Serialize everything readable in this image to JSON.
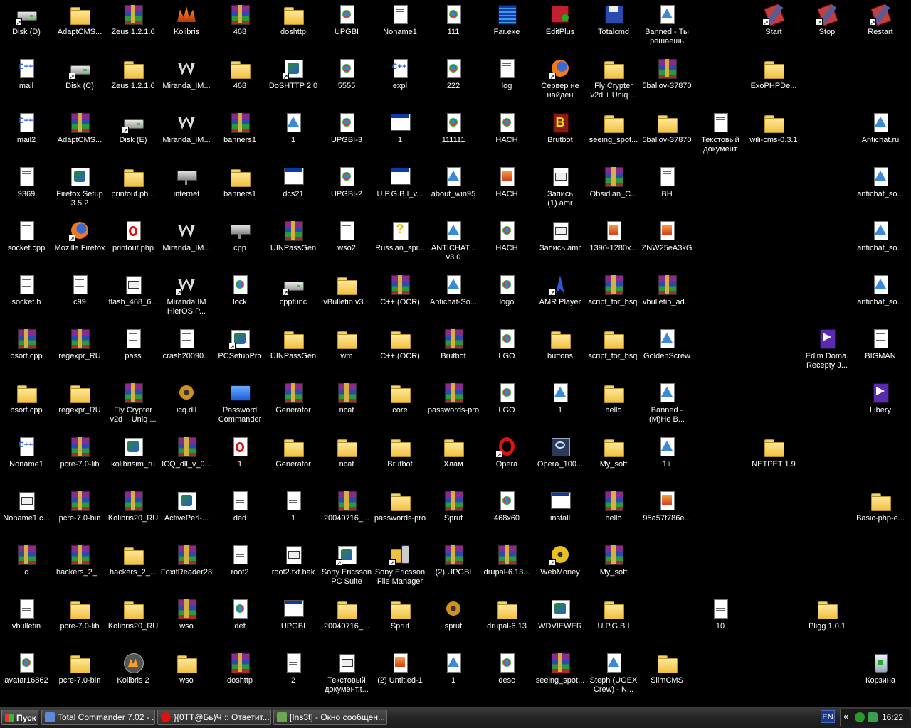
{
  "desktop": {
    "icons": [
      {
        "label": "Disk (D)",
        "glyph": "drive-icon",
        "shortcut": true
      },
      {
        "label": "AdaptCMS...",
        "glyph": "folder-icon"
      },
      {
        "label": "Zeus 1.2.1.6",
        "glyph": "rar-archive-icon"
      },
      {
        "label": "Kolibris",
        "glyph": "kolibri-icon"
      },
      {
        "label": "468",
        "glyph": "rar-archive-icon"
      },
      {
        "label": "doshttp",
        "glyph": "folder-icon"
      },
      {
        "label": "UPGBI",
        "glyph": "html-document-icon"
      },
      {
        "label": "Noname1",
        "glyph": "document-icon"
      },
      {
        "label": "111",
        "glyph": "html-document-icon"
      },
      {
        "label": "Far.exe",
        "glyph": "far-manager-icon"
      },
      {
        "label": "EditPlus",
        "glyph": "editplus-icon"
      },
      {
        "label": "Totalcmd",
        "glyph": "floppy-disk-icon"
      },
      {
        "label": "Banned - Ты решаешь",
        "glyph": "triangle-document-icon"
      },
      {
        "label": "Start",
        "glyph": "tool-flag-icon",
        "shortcut": true
      },
      {
        "label": "Stop",
        "glyph": "tool-flag-icon",
        "shortcut": true
      },
      {
        "label": "Restart",
        "glyph": "tool-flag-icon",
        "shortcut": true
      },
      {
        "label": "mail",
        "glyph": "cpp-file-icon"
      },
      {
        "label": "Disk (C)",
        "glyph": "drive-icon",
        "shortcut": true
      },
      {
        "label": "Zeus 1.2.1.6",
        "glyph": "folder-icon"
      },
      {
        "label": "Miranda_IM...",
        "glyph": "miranda-icon"
      },
      {
        "label": "468",
        "glyph": "folder-icon"
      },
      {
        "label": "DoSHTTP 2.0",
        "glyph": "application-icon",
        "shortcut": true
      },
      {
        "label": "5555",
        "glyph": "html-document-icon"
      },
      {
        "label": "expl",
        "glyph": "cpp-file-icon"
      },
      {
        "label": "222",
        "glyph": "html-document-icon"
      },
      {
        "label": "log",
        "glyph": "text-file-icon"
      },
      {
        "label": "Сервер не найден",
        "glyph": "firefox-icon",
        "shortcut": true
      },
      {
        "label": "Fly Crypter v2d + Uniq ...",
        "glyph": "folder-icon"
      },
      {
        "label": "5ballov-37870",
        "glyph": "rar-archive-icon"
      },
      {
        "label": "ExoPHPDe...",
        "glyph": "folder-icon"
      },
      {
        "label": "mail2",
        "glyph": "cpp-file-icon"
      },
      {
        "label": "AdaptCMS...",
        "glyph": "rar-archive-icon"
      },
      {
        "label": "Disk (E)",
        "glyph": "drive-icon",
        "shortcut": true
      },
      {
        "label": "Miranda_IM...",
        "glyph": "miranda-icon"
      },
      {
        "label": "banners1",
        "glyph": "rar-archive-icon"
      },
      {
        "label": "1",
        "glyph": "triangle-document-icon"
      },
      {
        "label": "UPGBI-3",
        "glyph": "html-document-icon"
      },
      {
        "label": "1",
        "glyph": "window-icon"
      },
      {
        "label": "111111",
        "glyph": "html-document-icon"
      },
      {
        "label": "HACH",
        "glyph": "html-document-icon"
      },
      {
        "label": "Brutbot",
        "glyph": "brutbot-icon"
      },
      {
        "label": "seeing_spot...",
        "glyph": "folder-icon"
      },
      {
        "label": "5ballov-37870",
        "glyph": "folder-icon"
      },
      {
        "label": "Текстовый документ",
        "glyph": "text-file-icon"
      },
      {
        "label": "wili-cms-0.3.1",
        "glyph": "folder-icon"
      },
      {
        "label": "Antichat.ru",
        "glyph": "triangle-document-icon"
      },
      {
        "label": "9369",
        "glyph": "text-file-icon"
      },
      {
        "label": "Firefox Setup 3.5.2",
        "glyph": "installer-icon"
      },
      {
        "label": "printout.ph...",
        "glyph": "folder-icon"
      },
      {
        "label": "internet",
        "glyph": "network-drive-icon"
      },
      {
        "label": "banners1",
        "glyph": "folder-icon"
      },
      {
        "label": "dcs21",
        "glyph": "window-icon"
      },
      {
        "label": "UPGBI-2",
        "glyph": "html-document-icon"
      },
      {
        "label": "U.P.G.B.I_v...",
        "glyph": "window-icon"
      },
      {
        "label": "about_win95",
        "glyph": "triangle-document-icon"
      },
      {
        "label": "HACH",
        "glyph": "image-document-icon"
      },
      {
        "label": "Запись (1).amr",
        "glyph": "executable-icon"
      },
      {
        "label": "Obsidian_C...",
        "glyph": "rar-archive-icon"
      },
      {
        "label": "BH",
        "glyph": "text-file-icon"
      },
      {
        "label": "antichat_so...",
        "glyph": "triangle-document-icon"
      },
      {
        "label": "socket.cpp",
        "glyph": "text-file-icon"
      },
      {
        "label": "Mozilla Firefox",
        "glyph": "firefox-icon",
        "shortcut": true
      },
      {
        "label": "printout.php",
        "glyph": "opera-document-icon"
      },
      {
        "label": "Miranda_IM...",
        "glyph": "miranda-icon"
      },
      {
        "label": "cpp",
        "glyph": "network-drive-icon"
      },
      {
        "label": "UINPassGen",
        "glyph": "rar-archive-icon"
      },
      {
        "label": "wso2",
        "glyph": "text-file-icon"
      },
      {
        "label": "Russian_spr...",
        "glyph": "help-file-icon"
      },
      {
        "label": "ANTICHAT... v3.0",
        "glyph": "triangle-document-icon"
      },
      {
        "label": "HACH",
        "glyph": "html-document-icon"
      },
      {
        "label": "Запись.amr",
        "glyph": "executable-icon"
      },
      {
        "label": "1390-1280x...",
        "glyph": "image-document-icon"
      },
      {
        "label": "ZNW25eA3kG",
        "glyph": "image-document-icon"
      },
      {
        "label": "antichat_so...",
        "glyph": "triangle-document-icon"
      },
      {
        "label": "socket.h",
        "glyph": "text-file-icon"
      },
      {
        "label": "c99",
        "glyph": "text-file-icon"
      },
      {
        "label": "flash_468_6...",
        "glyph": "executable-icon"
      },
      {
        "label": "Miranda IM HierOS P...",
        "glyph": "miranda-icon",
        "shortcut": true
      },
      {
        "label": "lock",
        "glyph": "html-document-icon"
      },
      {
        "label": "cppfunc",
        "glyph": "drive-icon",
        "shortcut": true
      },
      {
        "label": "vBulletin.v3...",
        "glyph": "folder-icon"
      },
      {
        "label": "C++ (OCR)",
        "glyph": "rar-archive-icon"
      },
      {
        "label": "Antichat-So...",
        "glyph": "triangle-document-icon"
      },
      {
        "label": "logo",
        "glyph": "html-document-icon"
      },
      {
        "label": "AMR Player",
        "glyph": "amr-player-icon",
        "shortcut": true
      },
      {
        "label": "script_for_bsql",
        "glyph": "rar-archive-icon"
      },
      {
        "label": "vbulletin_ad...",
        "glyph": "rar-archive-icon"
      },
      {
        "label": "antichat_so...",
        "glyph": "triangle-document-icon"
      },
      {
        "label": "bsort.cpp",
        "glyph": "rar-archive-icon"
      },
      {
        "label": "regexpr_RU",
        "glyph": "rar-archive-icon"
      },
      {
        "label": "pass",
        "glyph": "text-file-icon"
      },
      {
        "label": "crash20090...",
        "glyph": "text-file-icon"
      },
      {
        "label": "PCSetupPro",
        "glyph": "installer-icon",
        "shortcut": true
      },
      {
        "label": "UINPassGen",
        "glyph": "folder-icon"
      },
      {
        "label": "wm",
        "glyph": "folder-icon"
      },
      {
        "label": "C++ (OCR)",
        "glyph": "folder-icon"
      },
      {
        "label": "Brutbot",
        "glyph": "rar-archive-icon"
      },
      {
        "label": "LGO",
        "glyph": "html-document-icon"
      },
      {
        "label": "buttons",
        "glyph": "folder-icon"
      },
      {
        "label": "script_for_bsql",
        "glyph": "folder-icon"
      },
      {
        "label": "GoldenScrew",
        "glyph": "triangle-document-icon"
      },
      {
        "label": "Edim Doma. Recepty J...",
        "glyph": "edim-icon"
      },
      {
        "label": "BIGMAN",
        "glyph": "text-file-icon"
      },
      {
        "label": "bsort.cpp",
        "glyph": "folder-icon"
      },
      {
        "label": "regexpr_RU",
        "glyph": "folder-icon"
      },
      {
        "label": "Fly Crypter v2d + Uniq ...",
        "glyph": "rar-archive-icon"
      },
      {
        "label": "icq.dll",
        "glyph": "dll-gear-icon"
      },
      {
        "label": "Password Commander",
        "glyph": "password-commander-icon"
      },
      {
        "label": "Generator",
        "glyph": "rar-archive-icon"
      },
      {
        "label": "ncat",
        "glyph": "rar-archive-icon"
      },
      {
        "label": "core",
        "glyph": "folder-icon"
      },
      {
        "label": "passwords-pro",
        "glyph": "rar-archive-icon"
      },
      {
        "label": "LGO",
        "glyph": "html-document-icon"
      },
      {
        "label": "1",
        "glyph": "triangle-document-icon"
      },
      {
        "label": "hello",
        "glyph": "folder-icon"
      },
      {
        "label": "Banned - (M)He B...",
        "glyph": "triangle-document-icon"
      },
      {
        "label": "Libery",
        "glyph": "edim-icon"
      },
      {
        "label": "Noname1",
        "glyph": "cpp-file-icon"
      },
      {
        "label": "pcre-7.0-lib",
        "glyph": "rar-archive-icon"
      },
      {
        "label": "kolibrisim_ru",
        "glyph": "installer-icon"
      },
      {
        "label": "ICQ_dll_v_0...",
        "glyph": "rar-archive-icon"
      },
      {
        "label": "1",
        "glyph": "opera-document-icon"
      },
      {
        "label": "Generator",
        "glyph": "folder-icon"
      },
      {
        "label": "ncat",
        "glyph": "folder-icon"
      },
      {
        "label": "Brutbot",
        "glyph": "folder-icon"
      },
      {
        "label": "Хлам",
        "glyph": "folder-icon"
      },
      {
        "label": "Opera",
        "glyph": "opera-icon",
        "shortcut": true
      },
      {
        "label": "Opera_100...",
        "glyph": "opera-installer-icon"
      },
      {
        "label": "My_soft",
        "glyph": "folder-icon"
      },
      {
        "label": "1+",
        "glyph": "triangle-document-icon"
      },
      {
        "label": "NETPET 1.9",
        "glyph": "folder-icon"
      },
      {
        "label": "Noname1.c...",
        "glyph": "executable-icon"
      },
      {
        "label": "pcre-7.0-bin",
        "glyph": "rar-archive-icon"
      },
      {
        "label": "Kolibris20_RU",
        "glyph": "rar-archive-icon"
      },
      {
        "label": "ActivePerl-...",
        "glyph": "installer-icon"
      },
      {
        "label": "ded",
        "glyph": "text-file-icon"
      },
      {
        "label": "1",
        "glyph": "text-file-icon"
      },
      {
        "label": "20040716_...",
        "glyph": "rar-archive-icon"
      },
      {
        "label": "passwords-pro",
        "glyph": "folder-icon"
      },
      {
        "label": "Sprut",
        "glyph": "rar-archive-icon"
      },
      {
        "label": "468x60",
        "glyph": "html-document-icon"
      },
      {
        "label": "install",
        "glyph": "window-icon"
      },
      {
        "label": "hello",
        "glyph": "rar-archive-icon"
      },
      {
        "label": "95a57f786e...",
        "glyph": "image-document-icon"
      },
      {
        "label": "Basic-php-e...",
        "glyph": "folder-icon"
      },
      {
        "label": "c",
        "glyph": "rar-archive-icon"
      },
      {
        "label": "hackers_2_...",
        "glyph": "rar-archive-icon"
      },
      {
        "label": "hackers_2_...",
        "glyph": "folder-icon"
      },
      {
        "label": "FoxitReader23",
        "glyph": "rar-archive-icon"
      },
      {
        "label": "root2",
        "glyph": "text-file-icon"
      },
      {
        "label": "root2.txt.bak",
        "glyph": "executable-icon"
      },
      {
        "label": "Sony Ericsson PC Suite",
        "glyph": "installer-icon",
        "shortcut": true
      },
      {
        "label": "Sony Ericsson File Manager",
        "glyph": "phone-folder-icon",
        "shortcut": true
      },
      {
        "label": "(2) UPGBI",
        "glyph": "rar-archive-icon"
      },
      {
        "label": "drupal-6.13...",
        "glyph": "rar-archive-icon"
      },
      {
        "label": "WebMoney",
        "glyph": "webmoney-icon",
        "shortcut": true
      },
      {
        "label": "My_soft",
        "glyph": "rar-archive-icon"
      },
      {
        "label": "vbulletin",
        "glyph": "text-file-icon"
      },
      {
        "label": "pcre-7.0-lib",
        "glyph": "folder-icon"
      },
      {
        "label": "Kolibris20_RU",
        "glyph": "folder-icon"
      },
      {
        "label": "wso",
        "glyph": "rar-archive-icon"
      },
      {
        "label": "def",
        "glyph": "html-document-icon"
      },
      {
        "label": "UPGBI",
        "glyph": "window-icon"
      },
      {
        "label": "20040716_...",
        "glyph": "folder-icon"
      },
      {
        "label": "Sprut",
        "glyph": "folder-icon"
      },
      {
        "label": "sprut",
        "glyph": "dll-gear-icon"
      },
      {
        "label": "drupal-6.13",
        "glyph": "folder-icon"
      },
      {
        "label": "WDVIEWER",
        "glyph": "installer-icon"
      },
      {
        "label": "U.P.G.B.I",
        "glyph": "folder-icon"
      },
      {
        "label": "10",
        "glyph": "text-file-icon"
      },
      {
        "label": "Pligg 1.0.1",
        "glyph": "folder-icon"
      },
      {
        "label": "avatar16862",
        "glyph": "html-document-icon"
      },
      {
        "label": "pcre-7.0-bin",
        "glyph": "folder-icon"
      },
      {
        "label": "Kolibris 2",
        "glyph": "kolibri2-icon"
      },
      {
        "label": "wso",
        "glyph": "folder-icon"
      },
      {
        "label": "doshttp",
        "glyph": "rar-archive-icon"
      },
      {
        "label": "2",
        "glyph": "text-file-icon"
      },
      {
        "label": "Текстовый документ.t...",
        "glyph": "executable-icon"
      },
      {
        "label": "(2) Untitled-1",
        "glyph": "image-document-icon"
      },
      {
        "label": "1",
        "glyph": "triangle-document-icon"
      },
      {
        "label": "desc",
        "glyph": "html-document-icon"
      },
      {
        "label": "seeing_spot...",
        "glyph": "rar-archive-icon"
      },
      {
        "label": "Steph (UGEX Crew) - N...",
        "glyph": "triangle-document-icon"
      },
      {
        "label": "SlimCMS",
        "glyph": "folder-icon"
      },
      {
        "label": "Корзина",
        "glyph": "recycle-bin-icon"
      }
    ]
  },
  "taskbar": {
    "start_label": "Пуск",
    "tasks": [
      {
        "label": "Total Commander 7.02 - ...",
        "icon": "total-commander-icon",
        "color": "#5a8ad8"
      },
      {
        "label": "}{0TT@Бь)Ч :: Ответит...",
        "icon": "opera-icon",
        "color": "#e01010"
      },
      {
        "label": "[Ins3t] - Окно сообщен...",
        "icon": "chat-window-icon",
        "color": "#6aa84f"
      }
    ],
    "lang": "EN",
    "tray_chevron": "«",
    "clock": "16:22"
  }
}
